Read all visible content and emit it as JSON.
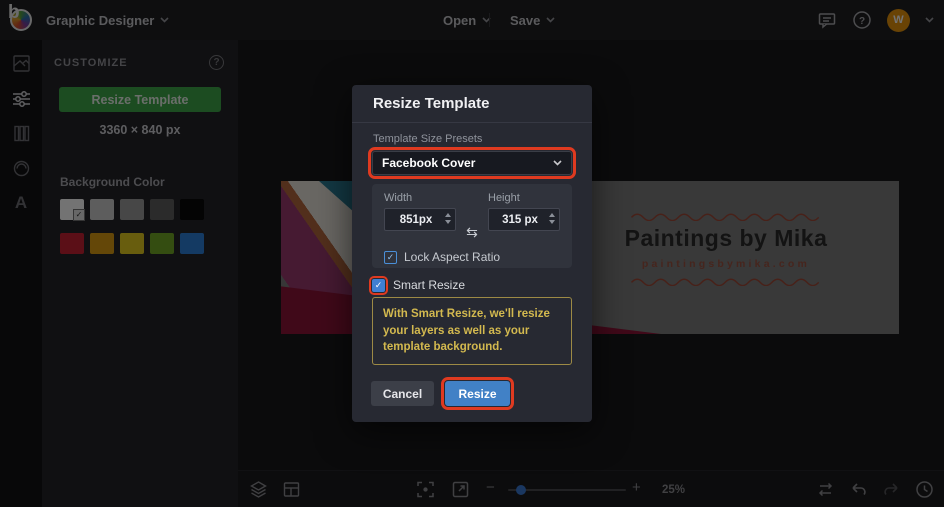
{
  "topbar": {
    "app_menu": {
      "label": "Graphic Designer"
    },
    "open_menu": {
      "label": "Open"
    },
    "save_menu": {
      "label": "Save"
    },
    "avatar": {
      "initial": "W"
    },
    "right_icons": [
      "comments-icon",
      "help-icon",
      "avatar",
      "account-chevron"
    ]
  },
  "sidebar": {
    "rail_icons": [
      "templates-icon",
      "customize-icon",
      "layouts-icon",
      "graphics-icon",
      "text-icon"
    ],
    "rail_active": "customize-icon",
    "panel": {
      "title": "CUSTOMIZE",
      "resize_button_label": "Resize Template",
      "dimensions": "3360 × 840 px",
      "background_color_label": "Background Color",
      "swatches": [
        [
          "#ffffff",
          "#cfcfcf",
          "#9e9e9e",
          "#5f5f5f",
          "#0a0a0a"
        ],
        [
          "#c92333",
          "#dd9d12",
          "#e7cf20",
          "#74aa26",
          "#2e82dc"
        ]
      ],
      "selected_swatch": "#ffffff"
    }
  },
  "canvas": {
    "design_title": "Paintings by Mika",
    "design_url": "paintingsbymika.com"
  },
  "modal": {
    "title": "Resize Template",
    "presets_label": "Template Size Presets",
    "preset_value": "Facebook Cover",
    "width_label": "Width",
    "width_value": "851px",
    "height_label": "Height",
    "height_value": "315 px",
    "lock_aspect_label": "Lock Aspect Ratio",
    "lock_aspect_checked": true,
    "smart_resize_label": "Smart Resize",
    "smart_resize_checked": true,
    "smart_resize_info": "With Smart Resize, we'll resize your layers as well as your template background.",
    "cancel_label": "Cancel",
    "resize_label": "Resize",
    "check_glyph": "✓",
    "swap_glyph": "⇆"
  },
  "toolbar": {
    "left_icons": [
      "layers-icon",
      "frames-icon"
    ],
    "center_icons": [
      "fit-screen-icon",
      "fullscreen-icon"
    ],
    "zoom_out_glyph": "−",
    "zoom_in_glyph": "+",
    "zoom_value": "25%",
    "right_icons": [
      "compare-icon",
      "undo-icon",
      "redo-icon",
      "history-icon"
    ]
  },
  "colors": {
    "annotation_red": "#df3a20",
    "accent_green": "#3fa94a",
    "accent_blue": "#4181c6",
    "checkbox_blue": "#3f7fd2",
    "info_yellow": "#d3b94f",
    "avatar_orange": "#e8960c",
    "slider_thumb_blue": "#3a7bd5"
  }
}
